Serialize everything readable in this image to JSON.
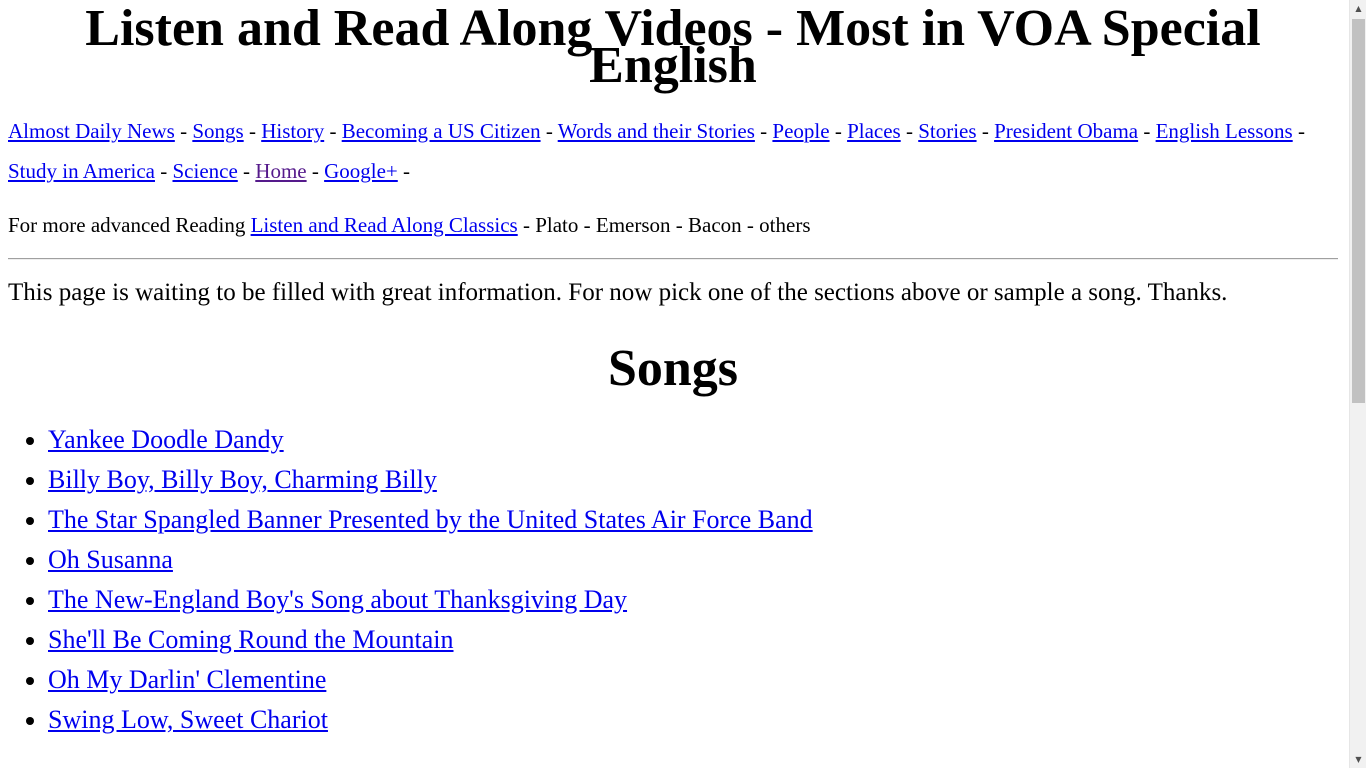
{
  "page": {
    "title": "Listen and Read Along Videos - Most in VOA Special English"
  },
  "nav": {
    "links": [
      "Almost Daily News",
      "Songs",
      "History",
      "Becoming a US Citizen",
      "Words and their Stories",
      "People",
      "Places",
      "Stories",
      "President Obama",
      "English Lessons",
      "Study in America",
      "Science",
      "Home",
      "Google+"
    ],
    "separator": "-"
  },
  "advanced": {
    "prefix": "For more advanced Reading",
    "link": "Listen and Read Along Classics",
    "suffix": "- Plato - Emerson - Bacon - others"
  },
  "intro": "This page is waiting to be filled with great information. For now pick one of the sections above or sample a song. Thanks.",
  "songs": {
    "heading": "Songs",
    "items": [
      "Yankee Doodle Dandy",
      "Billy Boy, Billy Boy, Charming Billy",
      "The Star Spangled Banner Presented by the United States Air Force Band",
      "Oh Susanna",
      "The New-England Boy's Song about Thanksgiving Day",
      "She'll Be Coming Round the Mountain",
      "Oh My Darlin' Clementine",
      "Swing Low, Sweet Chariot"
    ]
  },
  "scrollbar": {
    "up_icon": "triangle-up",
    "down_icon": "triangle-down"
  },
  "colors": {
    "link": "#0000ee",
    "visited_link": "#551a8b"
  }
}
